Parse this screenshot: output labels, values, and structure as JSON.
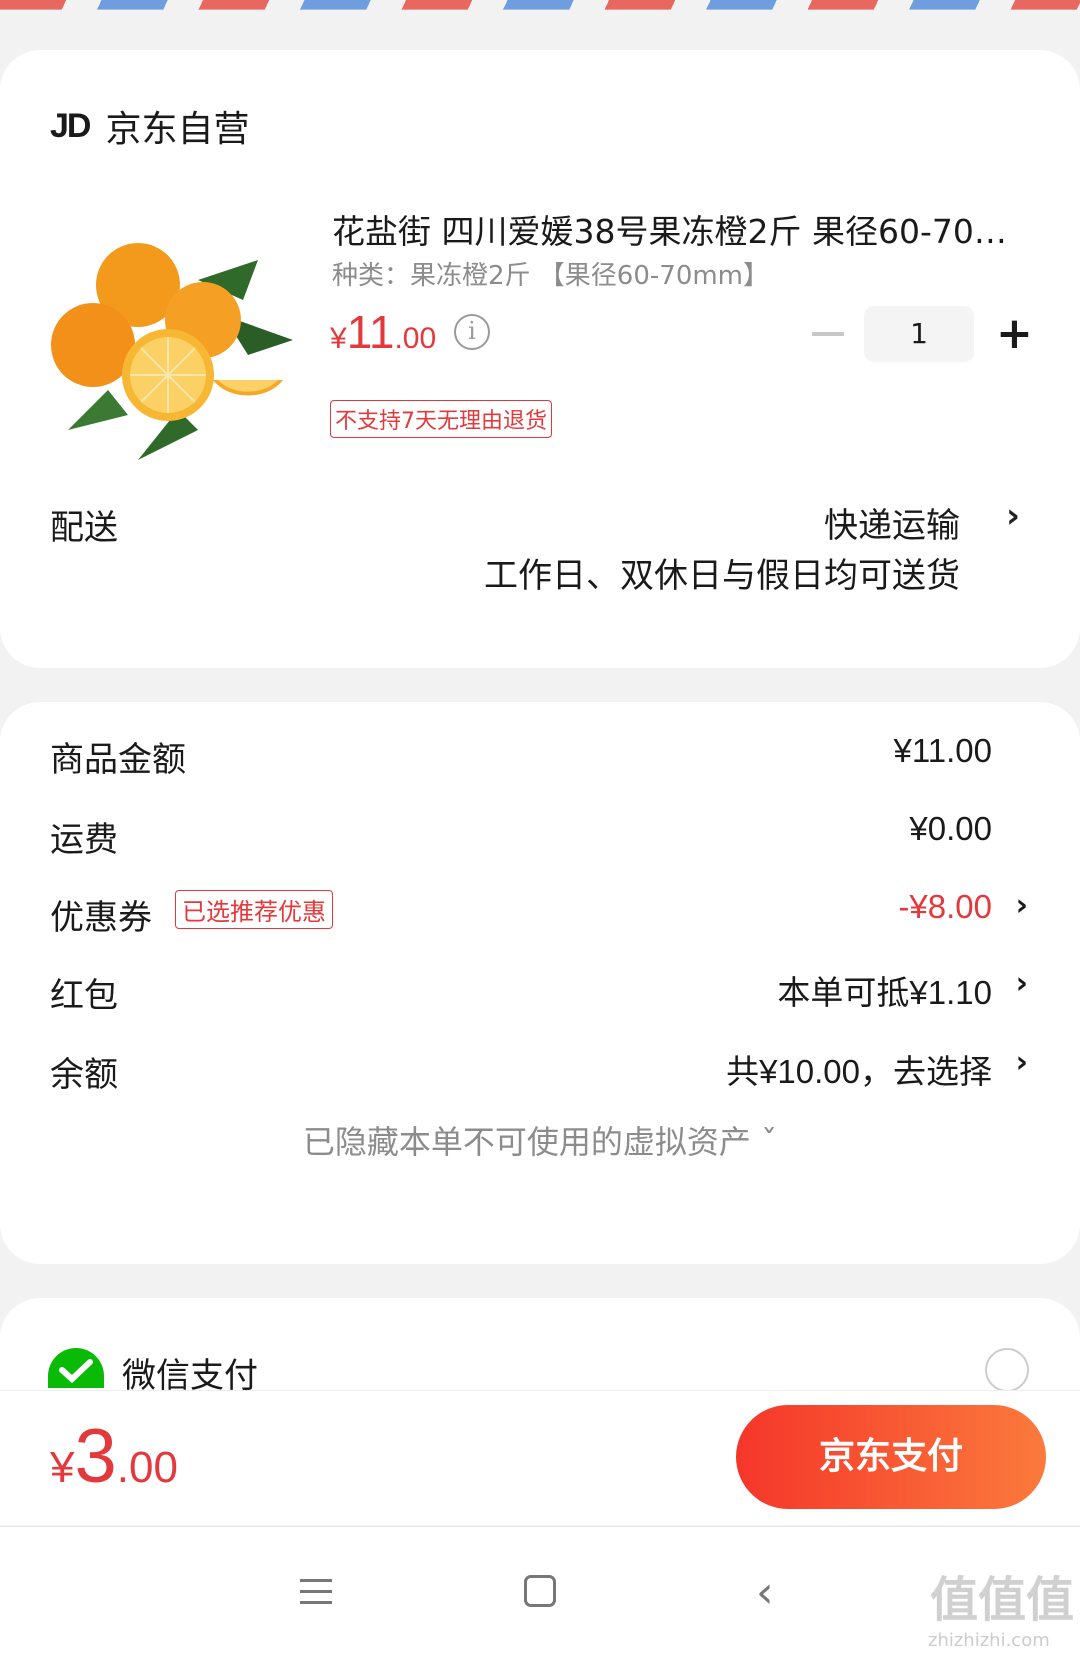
{
  "shop": {
    "logo": "JD",
    "name": "京东自营"
  },
  "product": {
    "title": "花盐街 四川爱媛38号果冻橙2斤 果径60-70mm",
    "spec": "种类：果冻橙2斤 【果径60-70mm】",
    "price_currency": "¥",
    "price_int": "11",
    "price_dec": ".00",
    "info_icon": "ⓘ",
    "quantity": "1",
    "minus_icon": "minus-icon",
    "plus_icon": "+",
    "no_return_tag": "不支持7天无理由退货"
  },
  "delivery": {
    "label": "配送",
    "method": "快递运输",
    "note": "工作日、双休日与假日均可送货",
    "chevron": "›"
  },
  "summary": {
    "items": [
      {
        "label": "商品金额",
        "value": "¥11.00"
      },
      {
        "label": "运费",
        "value": "¥0.00"
      },
      {
        "label": "优惠券",
        "tag": "已选推荐优惠",
        "value": "-¥8.00"
      },
      {
        "label": "红包",
        "value": "本单可抵¥1.10"
      },
      {
        "label": "余额",
        "value": "共¥10.00，去选择"
      }
    ],
    "chevron": "›",
    "hidden_note": "已隐藏本单不可使用的虚拟资产 ˇ"
  },
  "payment": {
    "wechat_label": "微信支付"
  },
  "paybar": {
    "total_currency": "¥",
    "total_int": "3",
    "total_dec": ".00",
    "pay_button": "京东支付"
  },
  "navbar": {
    "back": "‹"
  },
  "watermark": {
    "main": "值值值",
    "sub": "zhizhizhi.com"
  },
  "colors": {
    "accent": "#e4393c",
    "wechat": "#09bb07"
  }
}
